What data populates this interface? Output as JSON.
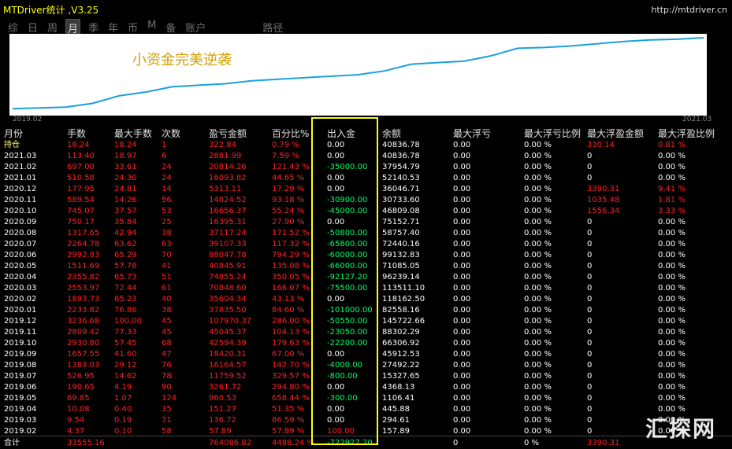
{
  "app": {
    "title": "MTDriver统计 ,V3.25",
    "url": "http://mtdriver.cn"
  },
  "tabs": [
    "综",
    "日",
    "周",
    "月",
    "季",
    "年",
    "币",
    "M",
    "备",
    "账户",
    "路径"
  ],
  "chart": {
    "title": "小资金完美逆袭",
    "start": "2019.02",
    "end": "2021.03",
    "line_color": "#1aa0e0",
    "values": [
      0.05,
      0.06,
      0.07,
      0.12,
      0.22,
      0.27,
      0.34,
      0.36,
      0.38,
      0.42,
      0.44,
      0.46,
      0.48,
      0.5,
      0.55,
      0.64,
      0.66,
      0.68,
      0.75,
      0.85,
      0.86,
      0.88,
      0.91,
      0.94,
      0.96,
      0.97,
      0.99
    ]
  },
  "columns": [
    "月份",
    "手数",
    "最大手数",
    "次数",
    "盈亏金额",
    "百分比%",
    "出入金",
    "余额",
    "最大浮亏",
    "最大浮亏比例",
    "最大浮盈金额",
    "最大浮盈比例"
  ],
  "rows": [
    [
      "持仓",
      "18.24",
      "18.24",
      "1",
      "322.84",
      "0.79 %",
      "0.00",
      "40836.78",
      "0.00",
      "0.00 %",
      "330.14",
      "0.81 %"
    ],
    [
      "2021.03",
      "113.40",
      "18.97",
      "6",
      "2881.99",
      "7.59 %",
      "0.00",
      "40836.78",
      "0.00",
      "0.00 %",
      "0",
      "0.00 %"
    ],
    [
      "2021.02",
      "697.00",
      "33.61",
      "24",
      "20814.26",
      "121.43 %",
      "-35000.00",
      "37954.79",
      "0.00",
      "0.00 %",
      "0",
      "0.00 %"
    ],
    [
      "2021.01",
      "510.58",
      "24.30",
      "24",
      "16093.82",
      "44.65 %",
      "0.00",
      "52140.53",
      "0.00",
      "0.00 %",
      "0",
      "0.00 %"
    ],
    [
      "2020.12",
      "177.95",
      "24.81",
      "14",
      "5313.11",
      "17.29 %",
      "0.00",
      "36046.71",
      "0.00",
      "0.00 %",
      "3390.31",
      "9.41 %"
    ],
    [
      "2020.11",
      "589.54",
      "14.26",
      "56",
      "14824.52",
      "93.18 %",
      "-30900.00",
      "30733.60",
      "0.00",
      "0.00 %",
      "1035.48",
      "1.81 %"
    ],
    [
      "2020.10",
      "745.07",
      "37.57",
      "53",
      "16656.37",
      "55.24 %",
      "-45000.00",
      "46809.08",
      "0.00",
      "0.00 %",
      "1556.34",
      "3.33 %"
    ],
    [
      "2020.09",
      "750.17",
      "35.84",
      "25",
      "16395.31",
      "27.90 %",
      "0.00",
      "75152.71",
      "0.00",
      "0.00 %",
      "0",
      "0.00 %"
    ],
    [
      "2020.08",
      "1317.65",
      "42.94",
      "38",
      "37117.24",
      "171.52 %",
      "-50800.00",
      "58757.40",
      "0.00",
      "0.00 %",
      "0",
      "0.00 %"
    ],
    [
      "2020.07",
      "2264.78",
      "63.62",
      "63",
      "39107.33",
      "117.32 %",
      "-65800.00",
      "72440.16",
      "0.00",
      "0.00 %",
      "0",
      "0.00 %"
    ],
    [
      "2020.06",
      "2992.83",
      "65.29",
      "70",
      "88047.78",
      "794.29 %",
      "-60000.00",
      "99132.83",
      "0.00",
      "0.00 %",
      "0",
      "0.00 %"
    ],
    [
      "2020.05",
      "1511.69",
      "57.78",
      "41",
      "40845.91",
      "135.08 %",
      "-66000.00",
      "71085.05",
      "0.00",
      "0.00 %",
      "0",
      "0.00 %"
    ],
    [
      "2020.04",
      "2355.82",
      "65.73",
      "51",
      "74855.24",
      "350.05 %",
      "-92127.20",
      "96239.14",
      "0.00",
      "0.00 %",
      "0",
      "0.00 %"
    ],
    [
      "2020.03",
      "2553.97",
      "72.44",
      "61",
      "70848.60",
      "166.07 %",
      "-75500.00",
      "113511.10",
      "0.00",
      "0.00 %",
      "0",
      "0.00 %"
    ],
    [
      "2020.02",
      "1893.73",
      "65.23",
      "40",
      "35604.34",
      "43.13 %",
      "0.00",
      "118162.50",
      "0.00",
      "0.00 %",
      "0",
      "0.00 %"
    ],
    [
      "2020.01",
      "2233.82",
      "76.86",
      "38",
      "37835.50",
      "84.60 %",
      "-101000.00",
      "82558.16",
      "0.00",
      "0.00 %",
      "0",
      "0.00 %"
    ],
    [
      "2019.12",
      "3236.68",
      "100.00",
      "45",
      "107970.37",
      "286.00 %",
      "-50550.00",
      "145722.66",
      "0.00",
      "0.00 %",
      "0",
      "0.00 %"
    ],
    [
      "2019.11",
      "2809.42",
      "77.33",
      "45",
      "45045.37",
      "104.13 %",
      "-23050.00",
      "88302.29",
      "0.00",
      "0.00 %",
      "0",
      "0.00 %"
    ],
    [
      "2019.10",
      "2930.80",
      "57.45",
      "68",
      "42594.39",
      "179.63 %",
      "-22200.00",
      "66306.92",
      "0.00",
      "0.00 %",
      "0",
      "0.00 %"
    ],
    [
      "2019.09",
      "1657.55",
      "41.60",
      "47",
      "18420.31",
      "67.00 %",
      "0.00",
      "45912.53",
      "0.00",
      "0.00 %",
      "0",
      "0.00 %"
    ],
    [
      "2019.08",
      "1383.03",
      "29.12",
      "76",
      "16164.57",
      "142.70 %",
      "-4000.00",
      "27492.22",
      "0.00",
      "0.00 %",
      "0",
      "0.00 %"
    ],
    [
      "2019.07",
      "526.95",
      "14.62",
      "78",
      "11759.52",
      "329.57 %",
      "-800.00",
      "15327.65",
      "0.00",
      "0.00 %",
      "0",
      "0.00 %"
    ],
    [
      "2019.06",
      "190.65",
      "4.19",
      "90",
      "3261.72",
      "294.80 %",
      "0.00",
      "4368.13",
      "0.00",
      "0.00 %",
      "0",
      "0.00 %"
    ],
    [
      "2019.05",
      "69.85",
      "1.07",
      "124",
      "960.53",
      "658.44 %",
      "-300.00",
      "1106.41",
      "0.00",
      "0.00 %",
      "0",
      "0.00 %"
    ],
    [
      "2019.04",
      "10.08",
      "0.40",
      "35",
      "151.27",
      "51.35 %",
      "0.00",
      "445.88",
      "0.00",
      "0.00 %",
      "0",
      "0.00 %"
    ],
    [
      "2019.03",
      "9.54",
      "0.19",
      "71",
      "136.72",
      "86.59 %",
      "0.00",
      "294.61",
      "0.00",
      "0.00 %",
      "0",
      "0.00 %"
    ],
    [
      "2019.02",
      "4.37",
      "0.10",
      "58",
      "57.89",
      "57.89 %",
      "100.00",
      "157.89",
      "0.00",
      "0.00 %",
      "0",
      "0.00 %"
    ]
  ],
  "total": [
    "合计",
    "33555.16",
    "",
    "",
    "764086.82",
    "4488.24 %",
    "-722927.20",
    "",
    "0",
    "0 %",
    "3390.31",
    ""
  ],
  "watermark": "汇探网"
}
